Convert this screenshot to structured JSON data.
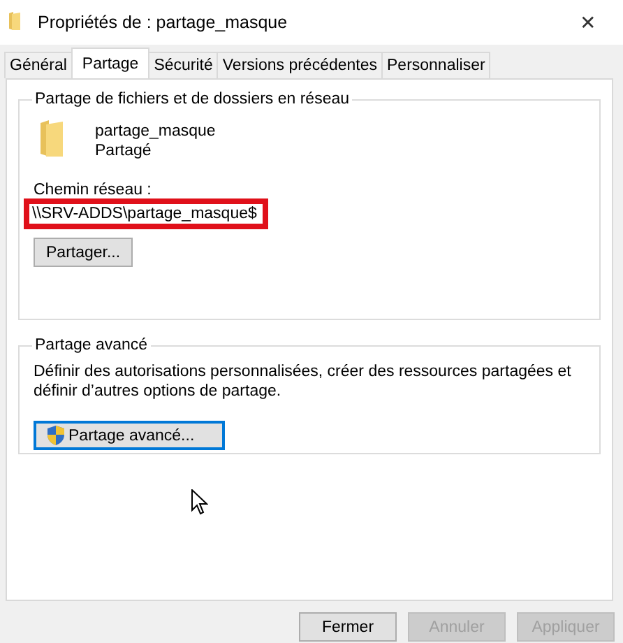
{
  "window": {
    "title": "Propriétés de : partage_masque",
    "close": "✕"
  },
  "tabs": [
    {
      "label": "Général",
      "selected": false
    },
    {
      "label": "Partage",
      "selected": true
    },
    {
      "label": "Sécurité",
      "selected": false
    },
    {
      "label": "Versions précédentes",
      "selected": false
    },
    {
      "label": "Personnaliser",
      "selected": false
    }
  ],
  "network_sharing": {
    "legend": "Partage de fichiers et de dossiers en réseau",
    "folder_name": "partage_masque",
    "folder_status": "Partagé",
    "path_label": "Chemin réseau :",
    "path": "\\\\SRV-ADDS\\partage_masque$",
    "path_highlighted": true,
    "button": "Partager..."
  },
  "advanced_sharing": {
    "legend": "Partage avancé",
    "description": "Définir des autorisations personnalisées, créer des ressources partagées et définir d’autres options de partage.",
    "button": "Partage avancé..."
  },
  "buttons": [
    {
      "label": "Fermer",
      "disabled": false
    },
    {
      "label": "Annuler",
      "disabled": true
    },
    {
      "label": "Appliquer",
      "disabled": true
    }
  ]
}
